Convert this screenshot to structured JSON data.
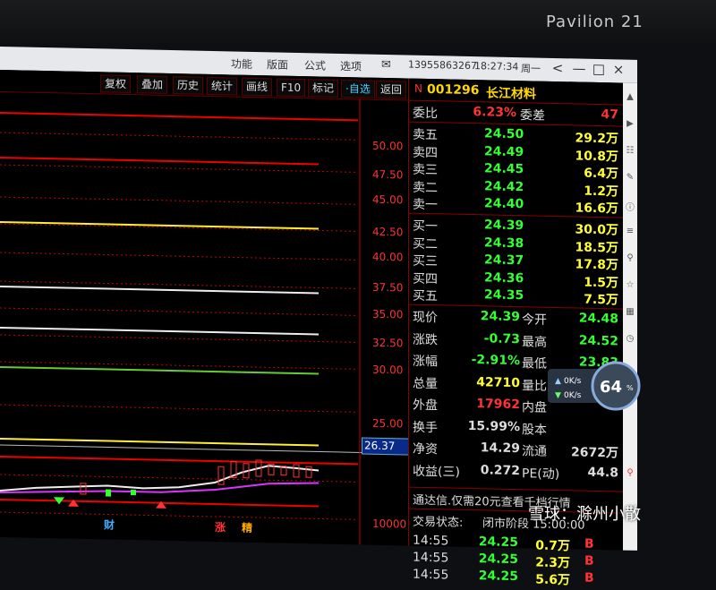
{
  "monitor": {
    "brand": "Pavilion 21"
  },
  "titlebar": {
    "menus": [
      "功能",
      "版面",
      "公式",
      "选项"
    ],
    "phone": "13955863267",
    "time": "18:27:34",
    "weekday": "周一",
    "controls": [
      "<",
      "—",
      "□",
      "×"
    ]
  },
  "toolbar": {
    "buttons": [
      "复权",
      "叠加",
      "历史",
      "统计",
      "画线",
      "F10",
      "标记",
      "·自选",
      "返回"
    ]
  },
  "chart": {
    "price_ticks": [
      "50.00",
      "47.50",
      "45.00",
      "42.50",
      "40.00",
      "37.50",
      "35.00",
      "32.50",
      "30.00",
      "25.00"
    ],
    "current_price_tag": "26.37",
    "volume_tick": "10000",
    "markers": [
      "财",
      "涨",
      "精"
    ]
  },
  "quote": {
    "code": "001296",
    "name": "长江材料",
    "weibi": {
      "label": "委比",
      "value": "6.23%",
      "label2": "委差",
      "value2": "47"
    },
    "sells": [
      {
        "label": "卖五",
        "price": "24.50",
        "vol": "29.2万"
      },
      {
        "label": "卖四",
        "price": "24.49",
        "vol": "10.8万"
      },
      {
        "label": "卖三",
        "price": "24.45",
        "vol": "6.4万"
      },
      {
        "label": "卖二",
        "price": "24.42",
        "vol": "1.2万"
      },
      {
        "label": "卖一",
        "price": "24.40",
        "vol": "16.6万"
      }
    ],
    "buys": [
      {
        "label": "买一",
        "price": "24.39",
        "vol": "30.0万"
      },
      {
        "label": "买二",
        "price": "24.38",
        "vol": "18.5万"
      },
      {
        "label": "买三",
        "price": "24.37",
        "vol": "17.8万"
      },
      {
        "label": "买四",
        "price": "24.36",
        "vol": "1.5万"
      },
      {
        "label": "买五",
        "price": "24.35",
        "vol": "7.5万"
      }
    ],
    "stats": [
      {
        "l1": "现价",
        "v1": "24.39",
        "l2": "今开",
        "v2": "24.48"
      },
      {
        "l1": "涨跌",
        "v1": "-0.73",
        "l2": "最高",
        "v2": "24.52"
      },
      {
        "l1": "涨幅",
        "v1": "-2.91%",
        "l2": "最低",
        "v2": "23.83"
      },
      {
        "l1": "总量",
        "v1": "42710",
        "l2": "量比",
        "v2": "0.7"
      },
      {
        "l1": "外盘",
        "v1": "17962",
        "l2": "内盘",
        "v2": ""
      },
      {
        "l1": "换手",
        "v1": "15.99%",
        "l2": "股本",
        "v2": ""
      },
      {
        "l1": "净资",
        "v1": "14.29",
        "l2": "流通",
        "v2": "2672万"
      },
      {
        "l1": "收益(三)",
        "v1": "0.272",
        "l2": "PE(动)",
        "v2": "44.8"
      }
    ],
    "notice": "通达信.仅需20元查看千档行情",
    "status_label": "交易状态:",
    "status_value": "闭市阶段 15:00:00",
    "ticks": [
      {
        "time": "14:55",
        "price": "24.25",
        "vol": "0.7万",
        "side": "B"
      },
      {
        "time": "14:55",
        "price": "24.25",
        "vol": "2.3万",
        "side": "B"
      },
      {
        "time": "14:55",
        "price": "24.25",
        "vol": "5.6万",
        "side": "B"
      }
    ]
  },
  "speed_widget": {
    "percent": "64",
    "unit": "%",
    "up": "0K/s",
    "down": "0K/s"
  },
  "watermark": "雪球：滁州小散",
  "colors": {
    "up": "#ff3333",
    "down": "#33ff33",
    "volume": "#ffff33",
    "grid": "#cc0000"
  }
}
